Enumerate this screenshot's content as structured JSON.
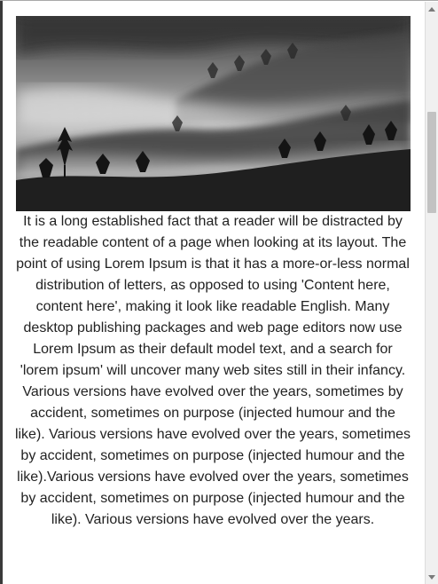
{
  "article": {
    "image": {
      "alt": "",
      "subject": "misty forested hills in black and white"
    },
    "text": "It is a long established fact that a reader will be distracted by the readable content of a page when looking at its layout. The point of using Lorem Ipsum is that it has a more-or-less normal distribution of letters, as opposed to using 'Content here, content here', making it look like readable English. Many desktop publishing packages and web page editors now use Lorem Ipsum as their default model text, and a search for 'lorem ipsum' will uncover many web sites still in their infancy. Various versions have evolved over the years, sometimes by accident, sometimes on purpose (injected humour and the like). Various versions have evolved over the years, sometimes by accident, sometimes on purpose (injected humour and the like).Various versions have evolved over the years, sometimes by accident, sometimes on purpose (injected humour and the like). Various versions have evolved over the years."
  },
  "scrollbar": {
    "position_fraction": 0.19,
    "visible_fraction": 0.18
  },
  "colors": {
    "text": "#222222",
    "background": "#ffffff",
    "scroll_thumb": "#c2c2c2"
  }
}
